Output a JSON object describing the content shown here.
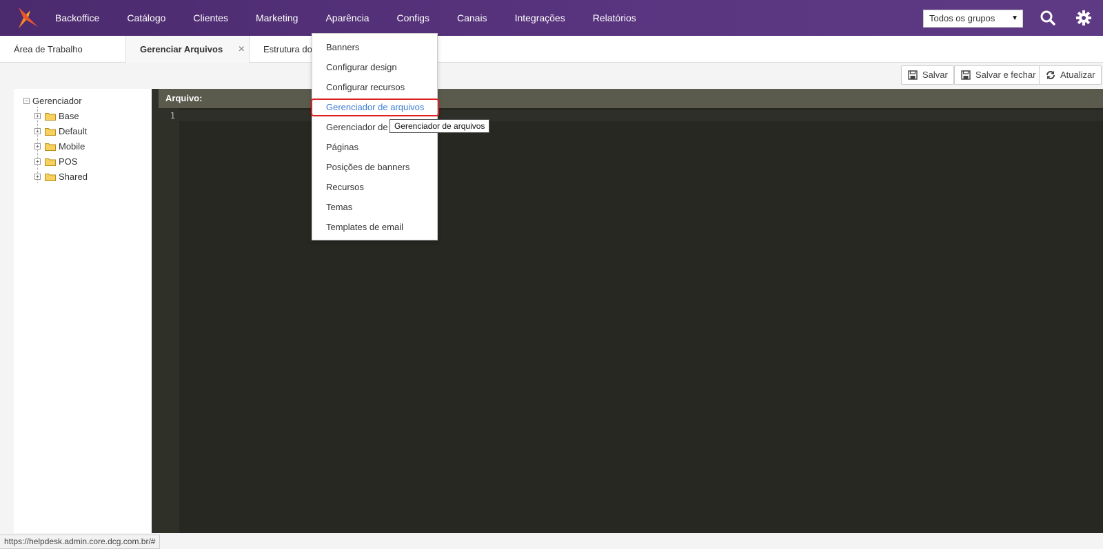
{
  "colors": {
    "topbar": "#5a3580",
    "accent": "#3a7bd5",
    "highlight_border": "#e02020",
    "editor_bg": "#272822"
  },
  "nav": {
    "items": [
      "Backoffice",
      "Catálogo",
      "Clientes",
      "Marketing",
      "Aparência",
      "Configs",
      "Canais",
      "Integrações",
      "Relatórios"
    ]
  },
  "header": {
    "group_select": "Todos os grupos",
    "search_icon": "search-icon",
    "settings_icon": "gear-icon"
  },
  "tabs": [
    {
      "label": "Área de Trabalho"
    },
    {
      "label": "Gerenciar Arquivos",
      "close": "×"
    },
    {
      "label": "Estrutura do S"
    }
  ],
  "toolbar": {
    "save_label": "Salvar",
    "save_close_label": "Salvar e fechar",
    "refresh_label": "Atualizar"
  },
  "tree": {
    "root": "Gerenciador",
    "root_toggle": "−",
    "children": [
      "Base",
      "Default",
      "Mobile",
      "POS",
      "Shared"
    ],
    "child_toggle": "+"
  },
  "editor": {
    "header": "Arquivo:",
    "line_number": "1"
  },
  "menu": {
    "items": [
      "Banners",
      "Configurar design",
      "Configurar recursos",
      "Gerenciador de arquivos",
      "Gerenciador de",
      "Páginas",
      "Posições de banners",
      "Recursos",
      "Temas",
      "Templates de email"
    ],
    "highlighted_index": 3,
    "tooltip": "Gerenciador de arquivos"
  },
  "status": {
    "url": "https://helpdesk.admin.core.dcg.com.br/#"
  }
}
